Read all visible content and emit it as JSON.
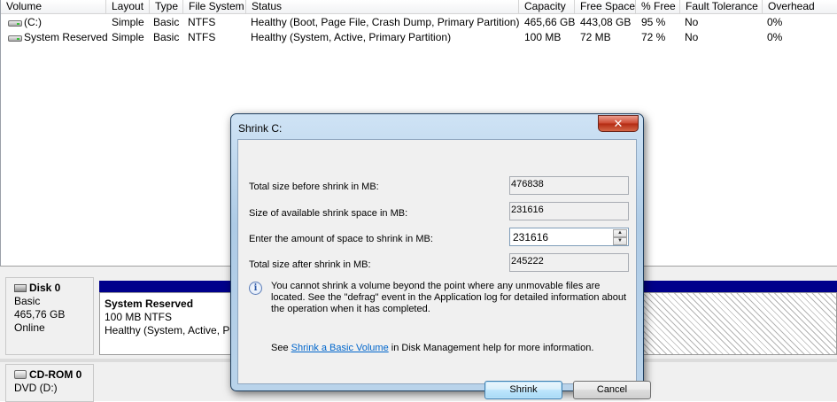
{
  "volume_list": {
    "columns": [
      "Volume",
      "Layout",
      "Type",
      "File System",
      "Status",
      "Capacity",
      "Free Space",
      "% Free",
      "Fault Tolerance",
      "Overhead"
    ],
    "rows": [
      {
        "volume": "(C:)",
        "layout": "Simple",
        "type": "Basic",
        "file_system": "NTFS",
        "status": "Healthy (Boot, Page File, Crash Dump, Primary Partition)",
        "capacity": "465,66 GB",
        "free_space": "443,08 GB",
        "pct_free": "95 %",
        "fault_tolerance": "No",
        "overhead": "0%"
      },
      {
        "volume": "System Reserved",
        "layout": "Simple",
        "type": "Basic",
        "file_system": "NTFS",
        "status": "Healthy (System, Active, Primary Partition)",
        "capacity": "100 MB",
        "free_space": "72 MB",
        "pct_free": "72 %",
        "fault_tolerance": "No",
        "overhead": "0%"
      }
    ]
  },
  "disks": [
    {
      "name": "Disk 0",
      "type": "Basic",
      "size": "465,76 GB",
      "status": "Online"
    },
    {
      "name": "CD-ROM 0",
      "type": "DVD (D:)"
    }
  ],
  "partitions": {
    "system_reserved": {
      "name": "System Reserved",
      "size_fs": "100 MB NTFS",
      "status": "Healthy (System, Active, Pri"
    }
  },
  "dialog": {
    "title": "Shrink C:",
    "close_glyph": "✕",
    "total_before_label": "Total size before shrink in MB:",
    "total_before_value": "476838",
    "available_label": "Size of available shrink space in MB:",
    "available_value": "231616",
    "amount_label": "Enter the amount of space to shrink in MB:",
    "amount_value": "231616",
    "total_after_label": "Total size after shrink in MB:",
    "total_after_value": "245222",
    "info_text": "You cannot shrink a volume beyond the point where any unmovable files are located. See the \"defrag\" event in the Application log for detailed information about the operation when it has completed.",
    "help_prefix": "See ",
    "help_link": "Shrink a Basic Volume",
    "help_suffix": " in Disk Management help for more information.",
    "shrink_label": "Shrink",
    "cancel_label": "Cancel"
  }
}
